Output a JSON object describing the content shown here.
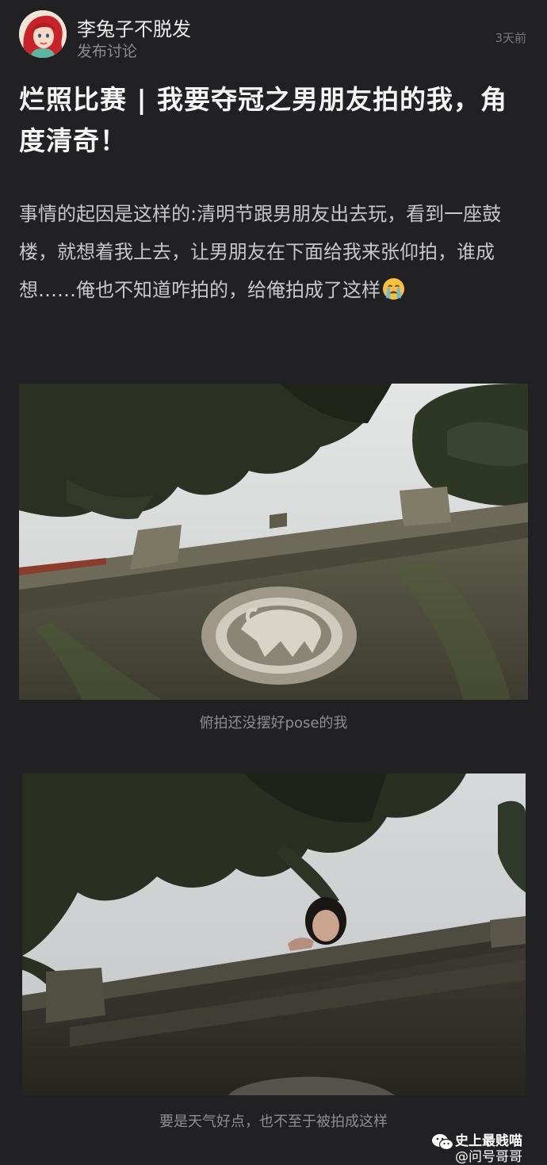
{
  "post": {
    "author": "李兔子不脱发",
    "type": "发布讨论",
    "time": "3天前",
    "avatar_icon": "red-haired-avatar",
    "title": "烂照比赛 | 我要夺冠之男朋友拍的我，角度清奇！",
    "body": "事情的起因是这样的:清明节跟男朋友出去玩，看到一座鼓楼，就想着我上去，让男朋友在下面给我来张仰拍，谁成想……俺也不知道咋拍的，给俺拍成了这样",
    "body_emoji": "crying-face-icon"
  },
  "photos": [
    {
      "subject": "low-angle view of drum tower wall with circular stone relief under pine branches",
      "caption": "俯拍还没摆好pose的我"
    },
    {
      "subject": "low-angle view of drum tower parapet with a girl's head peeking over, pine branches above",
      "caption": "要是天气好点，也不至于被拍成这样"
    }
  ],
  "watermark": {
    "icon": "wechat-icon",
    "line1": "史上最贱喵",
    "line2": "@问号哥哥"
  },
  "colors": {
    "background": "#212123",
    "title": "#f5f5f6",
    "body_text": "#c7c7ca",
    "caption": "#8e8e91"
  }
}
